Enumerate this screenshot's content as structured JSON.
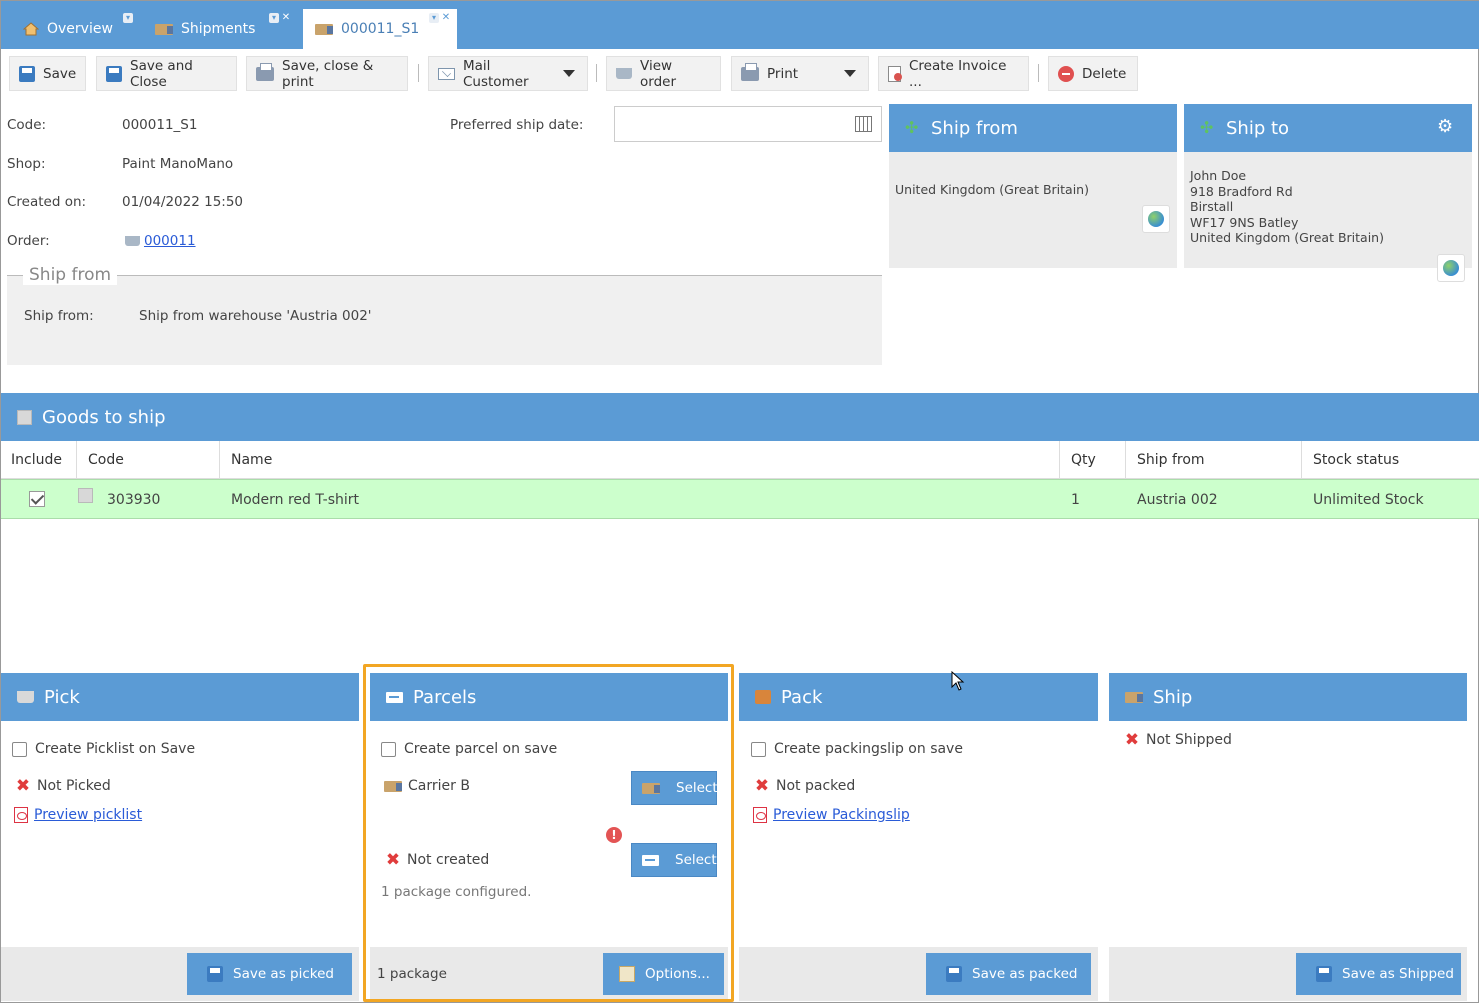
{
  "tabs": [
    {
      "label": "Overview",
      "icon": "home-icon"
    },
    {
      "label": "Shipments",
      "icon": "truck-icon"
    },
    {
      "label": "000011_S1",
      "icon": "truck-icon",
      "active": true
    }
  ],
  "toolbar": {
    "save": "Save",
    "save_close": "Save and Close",
    "save_close_print": "Save, close & print",
    "mail_customer": "Mail Customer",
    "view_order": "View order",
    "print": "Print",
    "create_invoice": "Create Invoice ...",
    "delete": "Delete"
  },
  "form": {
    "code_label": "Code:",
    "code_value": "000011_S1",
    "shop_label": "Shop:",
    "shop_value": "Paint ManoMano",
    "created_label": "Created on:",
    "created_value": "01/04/2022 15:50",
    "order_label": "Order:",
    "order_value": "000011",
    "preferred_date_label": "Preferred ship date:",
    "preferred_date_value": "",
    "shipfrom_legend": "Ship from",
    "shipfrom_label": "Ship from:",
    "shipfrom_value": "Ship from warehouse 'Austria 002'"
  },
  "ship_from_panel": {
    "title": "Ship from",
    "address": "United Kingdom (Great Britain)"
  },
  "ship_to_panel": {
    "title": "Ship to",
    "lines": [
      "John Doe",
      "918 Bradford Rd",
      "Birstall",
      "WF17 9NS Batley",
      "United Kingdom (Great Britain)"
    ]
  },
  "goods": {
    "title": "Goods to ship",
    "columns": [
      "Include",
      "Code",
      "Name",
      "Qty",
      "Ship from",
      "Stock status"
    ],
    "rows": [
      {
        "include": true,
        "code": "303930",
        "name": "Modern red T-shirt",
        "qty": "1",
        "ship_from": "Austria 002",
        "stock_status": "Unlimited Stock"
      }
    ]
  },
  "pick": {
    "title": "Pick",
    "create_label": "Create Picklist on Save",
    "status": "Not Picked",
    "preview_link": "Preview picklist",
    "button": "Save as picked"
  },
  "parcels": {
    "title": "Parcels",
    "create_label": "Create parcel on save",
    "carrier": "Carrier B",
    "carrier_button": "Select",
    "status": "Not created",
    "status_button": "Select",
    "configured": "1 package configured.",
    "footer_count": "1 package",
    "options_button": "Options..."
  },
  "pack": {
    "title": "Pack",
    "create_label": "Create packingslip on save",
    "status": "Not packed",
    "preview_link": "Preview Packingslip",
    "button": "Save as packed"
  },
  "ship": {
    "title": "Ship",
    "status": "Not Shipped",
    "button": "Save as Shipped"
  },
  "colors": {
    "accent": "#5b9bd5",
    "row_highlight": "#ccffcc",
    "focus_outline": "#f2a623",
    "error": "#e03c3c"
  }
}
